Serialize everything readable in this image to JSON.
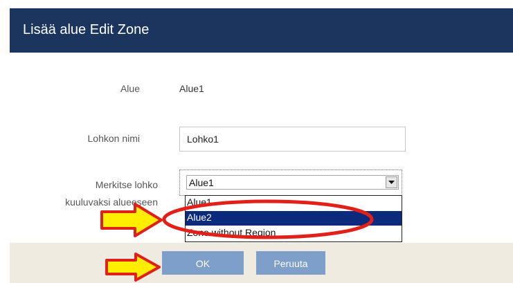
{
  "dialog": {
    "title": "Lisää alue Edit Zone"
  },
  "form": {
    "alue_label": "Alue",
    "alue_value": "Alue1",
    "lohkon_nimi_label": "Lohkon nimi",
    "lohkon_nimi_value": "Lohko1",
    "merkitse_label_line1": "Merkitse lohko",
    "merkitse_label_line2": "kuuluvaksi alueeseen",
    "select_value": "Alue1",
    "options": [
      "Alue1",
      "Alue2",
      "Zone without Region"
    ],
    "highlighted_option": "Alue2"
  },
  "buttons": {
    "ok": "OK",
    "cancel": "Peruuta"
  },
  "colors": {
    "header_bg": "#1b355e",
    "button_bg": "#7e9fca",
    "footer_bg": "#f0ebe0",
    "selected_option_bg": "#0b2a7c",
    "annotation_red": "#e1201a",
    "annotation_yellow": "#ffee00"
  }
}
